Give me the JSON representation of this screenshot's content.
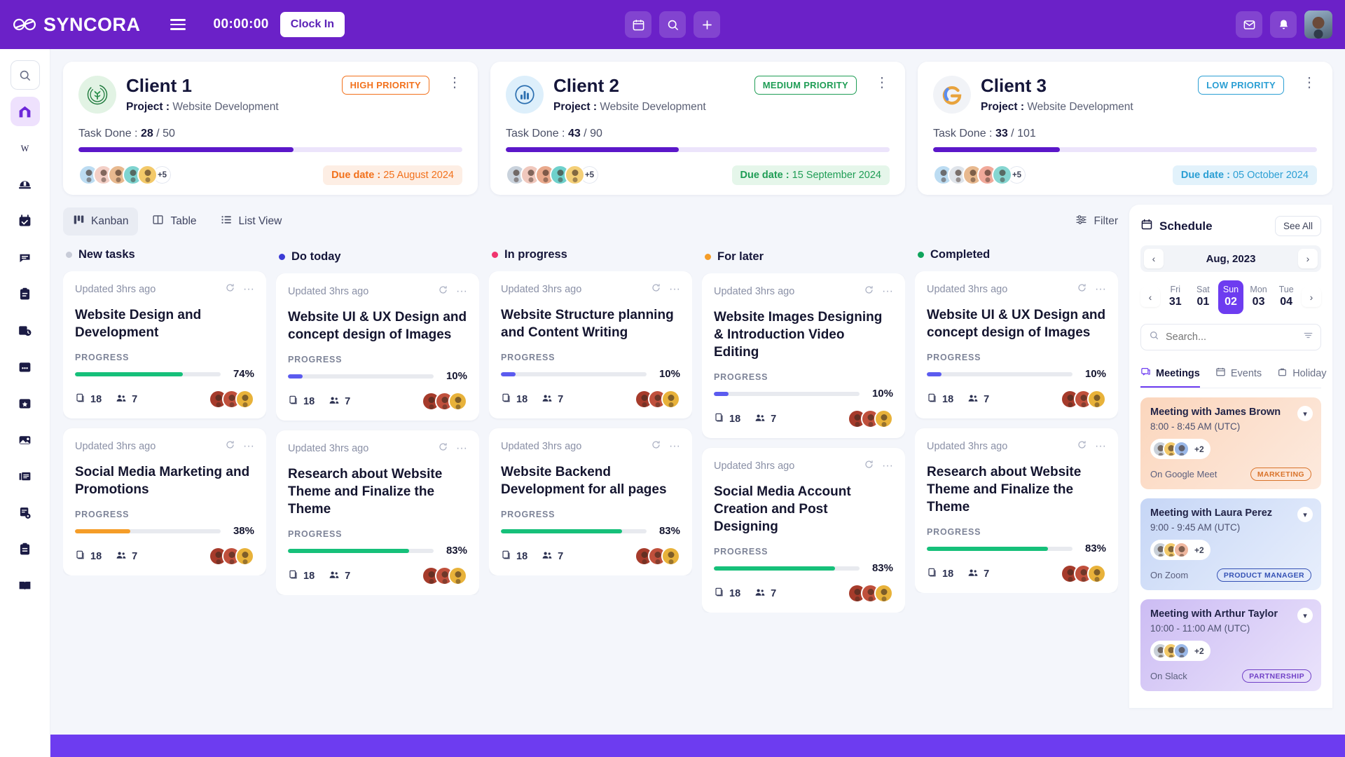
{
  "topbar": {
    "logo_text": "SYNCORA",
    "timer": "00:00:00",
    "clock_in_label": "Clock In",
    "center_icons": [
      "calendar-icon",
      "search-icon",
      "plus-icon"
    ],
    "right_icons": [
      "mail-icon",
      "bell-icon",
      "avatar"
    ],
    "accent": "#6b21c8"
  },
  "rail": {
    "search_label": "search-icon",
    "items": [
      {
        "name": "home-icon",
        "active": true
      },
      {
        "name": "wiki-icon",
        "active": false
      },
      {
        "name": "helmet-icon",
        "active": false
      },
      {
        "name": "calendar-check-icon",
        "active": false
      },
      {
        "name": "chat-icon",
        "active": false
      },
      {
        "name": "clipboard-list-icon",
        "active": false
      },
      {
        "name": "calendar-clock-icon",
        "active": false
      },
      {
        "name": "calendar-dots-icon",
        "active": false
      },
      {
        "name": "calendar-star-icon",
        "active": false
      },
      {
        "name": "image-icon",
        "active": false
      },
      {
        "name": "news-icon",
        "active": false
      },
      {
        "name": "settings-doc-icon",
        "active": false
      },
      {
        "name": "clipboard-icon",
        "active": false
      },
      {
        "name": "book-icon",
        "active": false
      }
    ]
  },
  "clients": [
    {
      "name": "Client 1",
      "project_label": "Project :",
      "project": "Website Development",
      "priority": "HIGH PRIORITY",
      "priority_color": "#f2711c",
      "priority_bg": "#ffffff",
      "logo_icon": "leaf-logo",
      "logo_bg": "#e2f3e4",
      "logo_color": "#1f7a3d",
      "task_label": "Task Done :",
      "done": 28,
      "total": 50,
      "progress_pct": 56,
      "avatars_extra": "+5",
      "due_label": "Due date :",
      "due_date": "25 August 2024",
      "due_color": "#f2711c",
      "due_bg": "#fdeee4"
    },
    {
      "name": "Client 2",
      "project_label": "Project :",
      "project": "Website Development",
      "priority": "MEDIUM PRIORITY",
      "priority_color": "#1f9d55",
      "priority_bg": "#ffffff",
      "logo_icon": "chart-logo",
      "logo_bg": "#ddeffb",
      "logo_color": "#2b6fb0",
      "task_label": "Task Done :",
      "done": 43,
      "total": 90,
      "progress_pct": 45,
      "avatars_extra": "+5",
      "due_label": "Due date :",
      "due_date": "15 September 2024",
      "due_color": "#1f9d55",
      "due_bg": "#e5f6ea"
    },
    {
      "name": "Client 3",
      "project_label": "Project :",
      "project": "Website Development",
      "priority": "LOW PRIORITY",
      "priority_color": "#2b9fd4",
      "priority_bg": "#ffffff",
      "logo_icon": "g-logo",
      "logo_bg": "#f1f3f7",
      "logo_color": "#e8a33d",
      "task_label": "Task Done :",
      "done": 33,
      "total": 101,
      "progress_pct": 33,
      "avatars_extra": "+5",
      "due_label": "Due date :",
      "due_date": "05 October 2024",
      "due_color": "#2b9fd4",
      "due_bg": "#e2f2fb"
    }
  ],
  "view_tabs": [
    {
      "label": "Kanban",
      "icon": "kanban-icon",
      "active": true
    },
    {
      "label": "Table",
      "icon": "table-icon",
      "active": false
    },
    {
      "label": "List View",
      "icon": "list-icon",
      "active": false
    }
  ],
  "filter_label": "Filter",
  "columns": [
    {
      "title": "New tasks",
      "dot": "#c8ccd8",
      "cards": [
        {
          "updated": "Updated 3hrs ago",
          "title": "Website Design and Development",
          "progress_label": "PROGRESS",
          "pct": 74,
          "pct_text": "74%",
          "bar_color": "#16c07a",
          "files": "18",
          "members": "7"
        },
        {
          "updated": "Updated 3hrs ago",
          "title": "Social Media Marketing and Promotions",
          "progress_label": "PROGRESS",
          "pct": 38,
          "pct_text": "38%",
          "bar_color": "#f59d28",
          "files": "18",
          "members": "7"
        }
      ]
    },
    {
      "title": "Do today",
      "dot": "#3b3bd6",
      "cards": [
        {
          "updated": "Updated 3hrs ago",
          "title": "Website UI & UX Design and concept design of Images",
          "progress_label": "PROGRESS",
          "pct": 10,
          "pct_text": "10%",
          "bar_color": "#5b5bef",
          "files": "18",
          "members": "7"
        },
        {
          "updated": "Updated 3hrs ago",
          "title": "Research about Website Theme and Finalize the Theme",
          "progress_label": "PROGRESS",
          "pct": 83,
          "pct_text": "83%",
          "bar_color": "#16c07a",
          "files": "18",
          "members": "7"
        }
      ]
    },
    {
      "title": "In progress",
      "dot": "#f0346e",
      "cards": [
        {
          "updated": "Updated 3hrs ago",
          "title": "Website Structure planning and Content Writing",
          "progress_label": "PROGRESS",
          "pct": 10,
          "pct_text": "10%",
          "bar_color": "#5b5bef",
          "files": "18",
          "members": "7"
        },
        {
          "updated": "Updated 3hrs ago",
          "title": "Website Backend Development for all pages",
          "progress_label": "PROGRESS",
          "pct": 83,
          "pct_text": "83%",
          "bar_color": "#16c07a",
          "files": "18",
          "members": "7"
        }
      ]
    },
    {
      "title": "For later",
      "dot": "#f59d28",
      "cards": [
        {
          "updated": "Updated 3hrs ago",
          "title": "Website Images Designing & Introduction Video Editing",
          "progress_label": "PROGRESS",
          "pct": 10,
          "pct_text": "10%",
          "bar_color": "#5b5bef",
          "files": "18",
          "members": "7"
        },
        {
          "updated": "Updated 3hrs ago",
          "title": "Social Media Account Creation and Post Designing",
          "progress_label": "PROGRESS",
          "pct": 83,
          "pct_text": "83%",
          "bar_color": "#16c07a",
          "files": "18",
          "members": "7"
        }
      ]
    },
    {
      "title": "Completed",
      "dot": "#0fa45c",
      "cards": [
        {
          "updated": "Updated 3hrs ago",
          "title": "Website UI & UX Design and concept design of Images",
          "progress_label": "PROGRESS",
          "pct": 10,
          "pct_text": "10%",
          "bar_color": "#5b5bef",
          "files": "18",
          "members": "7"
        },
        {
          "updated": "Updated 3hrs ago",
          "title": "Research about Website Theme and Finalize the Theme",
          "progress_label": "PROGRESS",
          "pct": 83,
          "pct_text": "83%",
          "bar_color": "#16c07a",
          "files": "18",
          "members": "7"
        }
      ]
    }
  ],
  "schedule": {
    "title": "Schedule",
    "see_all": "See All",
    "month": "Aug, 2023",
    "days": [
      {
        "weekday": "Fri",
        "num": "31",
        "selected": false
      },
      {
        "weekday": "Sat",
        "num": "01",
        "selected": false
      },
      {
        "weekday": "Sun",
        "num": "02",
        "selected": true
      },
      {
        "weekday": "Mon",
        "num": "03",
        "selected": false
      },
      {
        "weekday": "Tue",
        "num": "04",
        "selected": false
      }
    ],
    "search_placeholder": "Search...",
    "tabs": [
      {
        "label": "Meetings",
        "icon": "meeting-icon",
        "active": true
      },
      {
        "label": "Events",
        "icon": "events-calendar-icon",
        "active": false
      },
      {
        "label": "Holiday",
        "icon": "holiday-bag-icon",
        "active": false
      }
    ],
    "meetings": [
      {
        "title": "Meeting with James Brown",
        "time": "8:00 - 8:45 AM (UTC)",
        "avatars_extra": "+2",
        "platform": "On Google Meet",
        "tag": "MARKETING",
        "tag_color": "#d9732a",
        "bg_from": "#fbd9c2",
        "bg_to": "#fdeadd"
      },
      {
        "title": "Meeting with Laura Perez",
        "time": "9:00 - 9:45 AM (UTC)",
        "avatars_extra": "+2",
        "platform": "On Zoom",
        "tag": "PRODUCT MANAGER",
        "tag_color": "#3552b5",
        "bg_from": "#c9d8f6",
        "bg_to": "#e6edfb"
      },
      {
        "title": "Meeting with Arthur Taylor",
        "time": "10:00 - 11:00 AM (UTC)",
        "avatars_extra": "+2",
        "platform": "On Slack",
        "tag": "PARTNERSHIP",
        "tag_color": "#7141c7",
        "bg_from": "#cfc0f3",
        "bg_to": "#e9e2fb"
      }
    ]
  }
}
